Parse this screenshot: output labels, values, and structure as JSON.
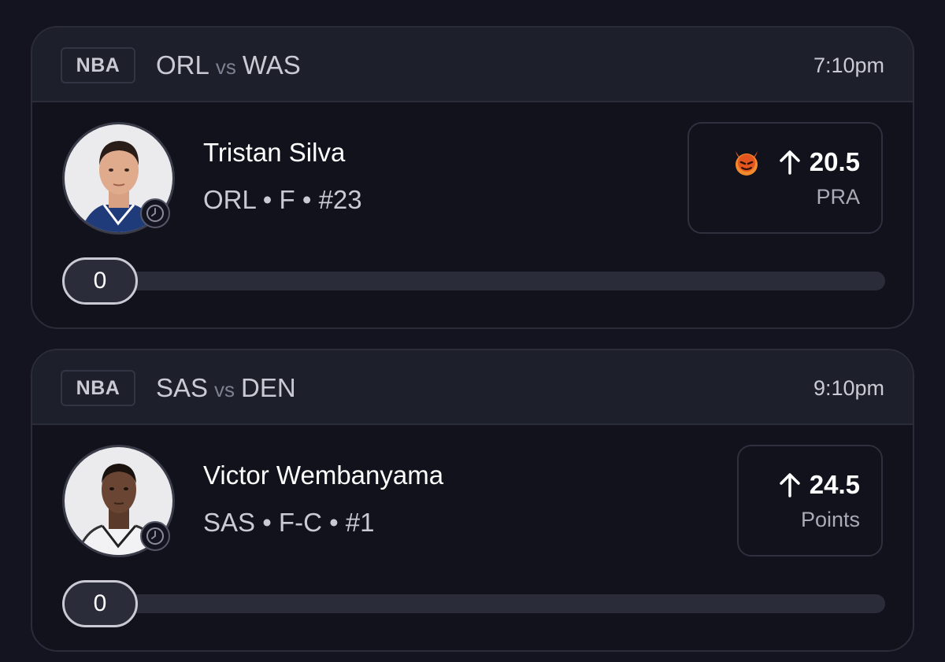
{
  "picks": [
    {
      "league": "NBA",
      "home_team": "ORL",
      "vs_label": "vs",
      "away_team": "WAS",
      "time": "7:10pm",
      "player_name": "Tristan Silva",
      "player_meta": "ORL • F • #23",
      "has_demon": true,
      "direction_icon": "arrow-up-icon",
      "line": "20.5",
      "stat": "PRA",
      "progress_value": "0",
      "progress_fraction": 0
    },
    {
      "league": "NBA",
      "home_team": "SAS",
      "vs_label": "vs",
      "away_team": "DEN",
      "time": "9:10pm",
      "player_name": "Victor Wembanyama",
      "player_meta": "SAS • F-C • #1",
      "has_demon": false,
      "direction_icon": "arrow-up-icon",
      "line": "24.5",
      "stat": "Points",
      "progress_value": "0",
      "progress_fraction": 0
    }
  ],
  "colors": {
    "background": "#13141f",
    "card": "#11121b",
    "header": "#1d1f2b",
    "border": "#2a2c3a",
    "text_primary": "#ffffff",
    "text_secondary": "#c9cad3",
    "demon": "#e2551f"
  }
}
